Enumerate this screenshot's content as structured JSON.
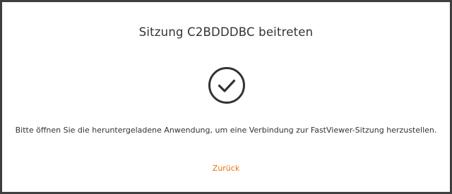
{
  "dialog": {
    "title": "Sitzung C2BDDDBC beitreten",
    "status_icon": "check-circle-icon",
    "message": "Bitte öffnen Sie die heruntergeladene Anwendung, um eine Verbindung zur FastViewer-Sitzung herzustellen.",
    "back_label": "Zurück"
  },
  "colors": {
    "text": "#333333",
    "icon": "#333333",
    "link": "#e8730c",
    "border": "#3e3e3e"
  }
}
